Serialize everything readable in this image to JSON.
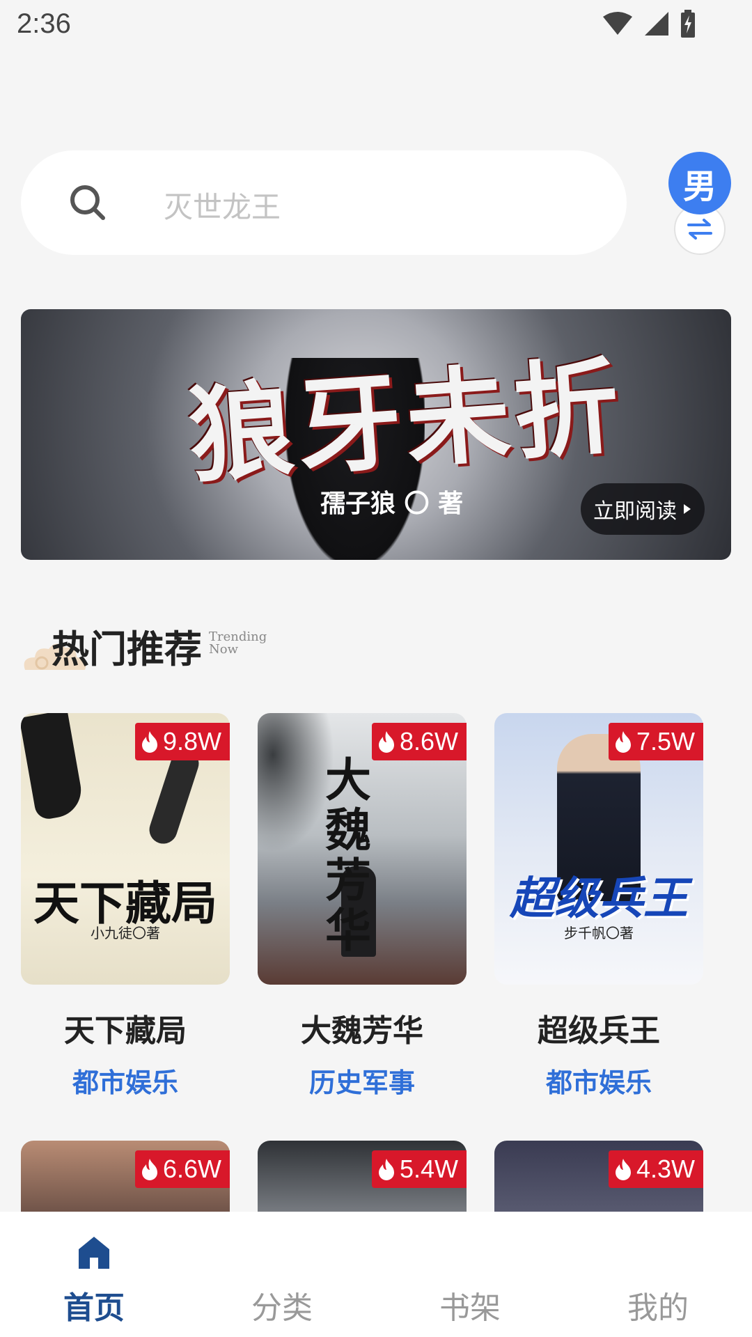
{
  "status": {
    "time": "2:36"
  },
  "search": {
    "placeholder": "灭世龙王"
  },
  "gender": {
    "label": "男"
  },
  "banner": {
    "title": "狼牙未折",
    "author": "孺子狼 〇 著",
    "button": "立即阅读"
  },
  "section": {
    "title": "热门推荐",
    "subtitle": "Trending Now"
  },
  "books": [
    {
      "name": "天下藏局",
      "category": "都市娱乐",
      "heat": "9.8W",
      "cover_title": "天下藏局",
      "cover_author": "小九徒〇著"
    },
    {
      "name": "大魏芳华",
      "category": "历史军事",
      "heat": "8.6W",
      "cover_title": "大魏芳华"
    },
    {
      "name": "超级兵王",
      "category": "都市娱乐",
      "heat": "7.5W",
      "cover_title": "超级兵王",
      "cover_author": "步千帆〇著"
    }
  ],
  "books_row2": [
    {
      "heat": "6.6W"
    },
    {
      "heat": "5.4W"
    },
    {
      "heat": "4.3W"
    }
  ],
  "tabs": [
    {
      "label": "首页",
      "active": true
    },
    {
      "label": "分类"
    },
    {
      "label": "书架"
    },
    {
      "label": "我的"
    }
  ],
  "colors": {
    "accent": "#3d7ef0",
    "heat_badge": "#d8182a",
    "category": "#2f6fd8",
    "tab_active": "#1e4d8f"
  }
}
